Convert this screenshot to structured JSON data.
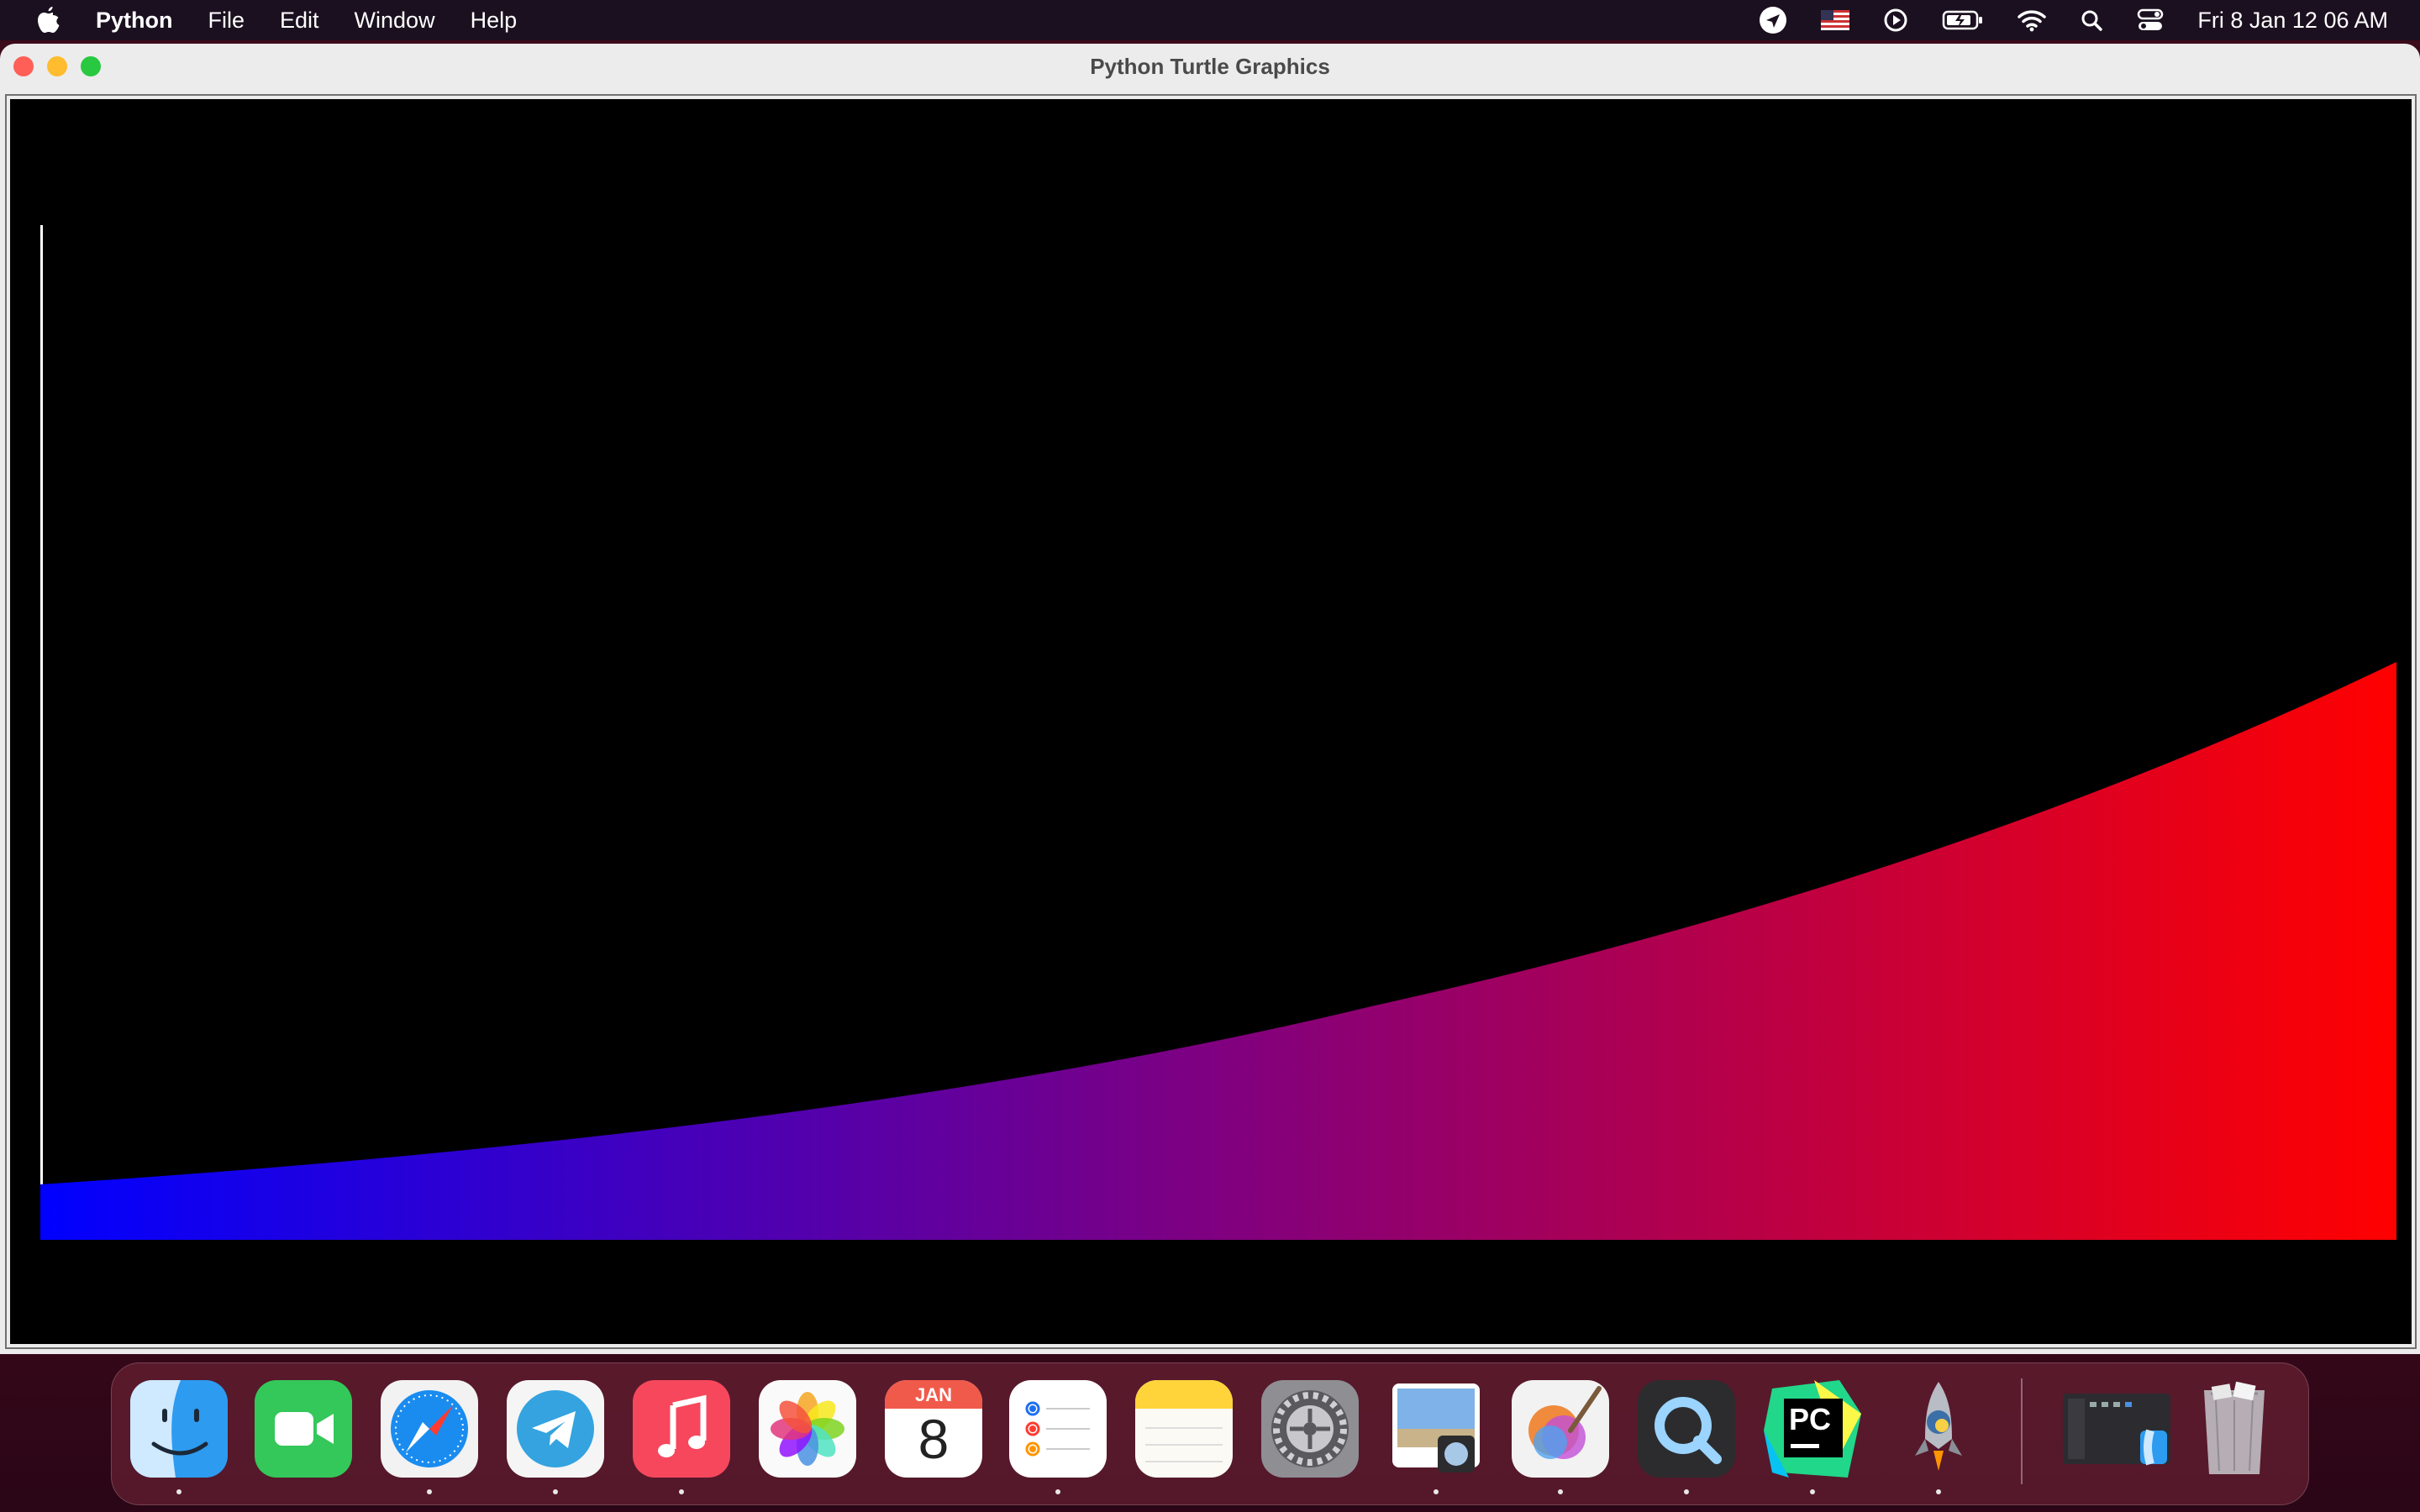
{
  "menubar": {
    "app_name": "Python",
    "menus": [
      "File",
      "Edit",
      "Window",
      "Help"
    ],
    "clock": "Fri 8 Jan  12 06 AM",
    "status_icons": [
      "location-icon",
      "us-flag-icon",
      "play-circle-icon",
      "battery-icon",
      "wifi-icon",
      "search-icon",
      "control-center-icon"
    ]
  },
  "window": {
    "title": "Python Turtle Graphics",
    "traffic_lights": {
      "close": "#ff5f57",
      "minimize": "#febc2e",
      "zoom": "#28c840"
    }
  },
  "canvas": {
    "background": "#000000",
    "fill_start_color": "#0000ff",
    "fill_end_color": "#ff0000",
    "axis_color": "#ffffff"
  },
  "dock": {
    "calendar_month": "JAN",
    "calendar_day": "8",
    "pycharm_label": "PC",
    "apps": [
      "finder",
      "facetime",
      "safari",
      "telegram",
      "music",
      "photos",
      "calendar",
      "reminders",
      "notes",
      "system-preferences",
      "preview",
      "pixelmator",
      "quicktime",
      "pycharm",
      "python-launcher",
      "downloads-stack",
      "trash"
    ]
  }
}
